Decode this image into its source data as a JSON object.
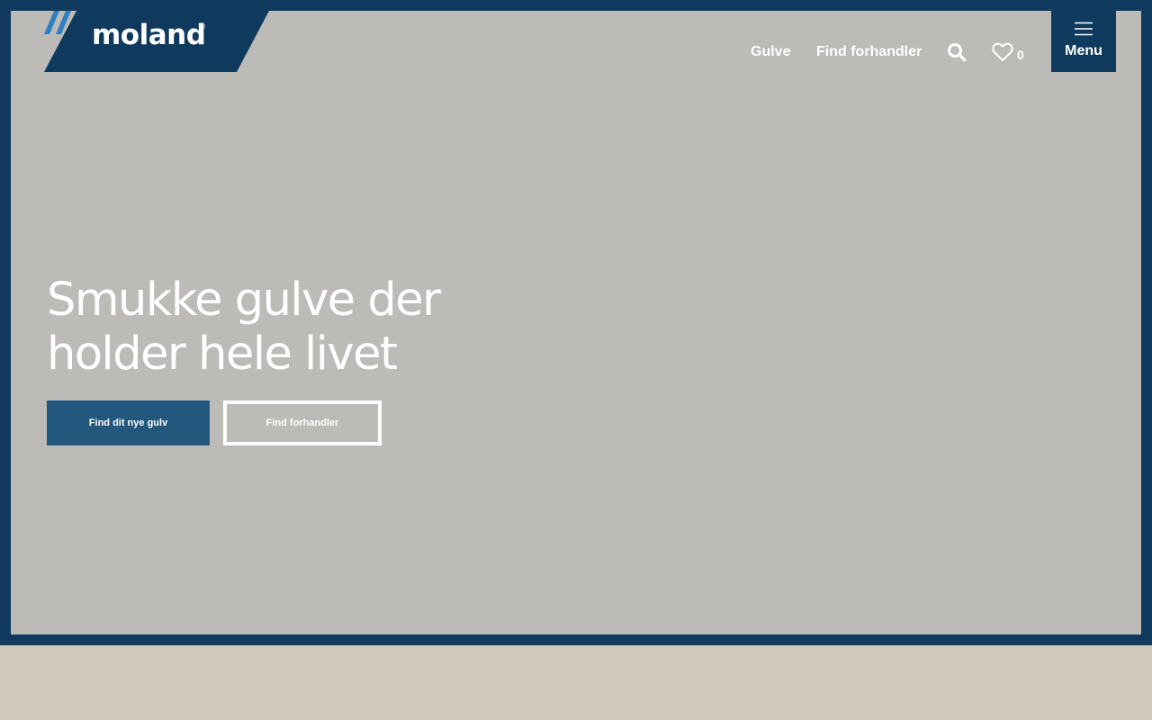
{
  "header": {
    "logo_text": "moland",
    "logo_mark": "®",
    "nav": {
      "gulve": "Gulve",
      "find_dealer": "Find forhandler"
    },
    "favorites_count": "0",
    "menu_label": "Menu",
    "icons": {
      "search": "search-icon",
      "favorites": "heart-icon",
      "menu": "hamburger-icon"
    }
  },
  "hero": {
    "headline_line1": "Smukke gulve der",
    "headline_line2": "holder hele livet",
    "primary_button": "Find dit nye gulv",
    "secondary_button": "Find forhandler"
  },
  "colors": {
    "brand_navy": "#0f3a5e",
    "button_blue": "#22587d",
    "hero_background": "#bdbbb7",
    "page_background": "#d0c9ba",
    "logo_accent": "#2f7fc1"
  }
}
